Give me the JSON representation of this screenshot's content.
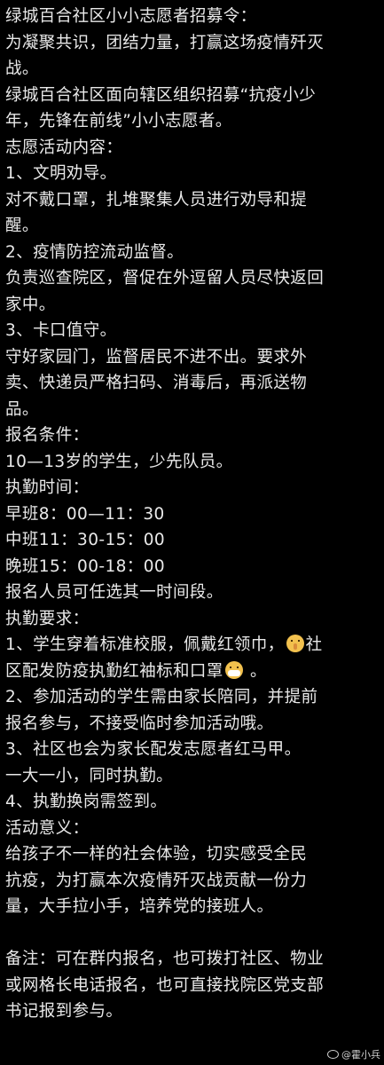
{
  "document": {
    "lines": [
      "绿城百合社区小小志愿者招募令：",
      "为凝聚共识，团结力量，打赢这场疫情歼灭",
      "战。",
      "绿城百合社区面向辖区组织招募“抗疫小少",
      "年，先锋在前线”小小志愿者。",
      "志愿活动内容：",
      "1、文明劝导。",
      "对不戴口罩，扎堆聚集人员进行劝导和提",
      "醒。",
      "2、疫情防控流动监督。",
      "负责巡查院区，督促在外逗留人员尽快返回",
      "家中。",
      "3、卡口值守。",
      "守好家园门，监督居民不进不出。要求外",
      "卖、快递员严格扫码、消毒后，再派送物",
      "品。",
      "报名条件：",
      "10—13岁的学生，少先队员。",
      "执勤时间：",
      "早班8：00—11：30",
      "中班11：30-15：00",
      "晚班15：00-18：00",
      "报名人员可任选其一时间段。",
      "执勤要求："
    ],
    "emoji_line": {
      "before": "1、学生穿着标准校服，佩戴红领巾，",
      "after": "社",
      "icon": "shushing-face-emoji"
    },
    "emoji_line2": {
      "before": "区配发防疫执勤红袖标和口罩",
      "after": " 。",
      "icon": "mask-face-emoji"
    },
    "lines2": [
      "2、参加活动的学生需由家长陪同，并提前",
      "报名参与，不接受临时参加活动哦。",
      "3、社区也会为家长配发志愿者红马甲。",
      "一大一小，同时执勤。",
      "4、执勤换岗需签到。",
      "活动意义：",
      "给孩子不一样的社会体验，切实感受全民",
      "抗疫，为打赢本次疫情歼灭战贡献一份力",
      "量，大手拉小手，培养党的接班人。"
    ],
    "lines3": [
      "备注：可在群内报名，也可拨打社区、物业",
      "或网格长电话报名，也可直接找院区党支部",
      "书记报到参与。"
    ]
  },
  "watermark": {
    "text": "@霍小兵",
    "icon": "weibo-icon"
  },
  "colors": {
    "background": "#000000",
    "text": "#e9e9e9"
  }
}
